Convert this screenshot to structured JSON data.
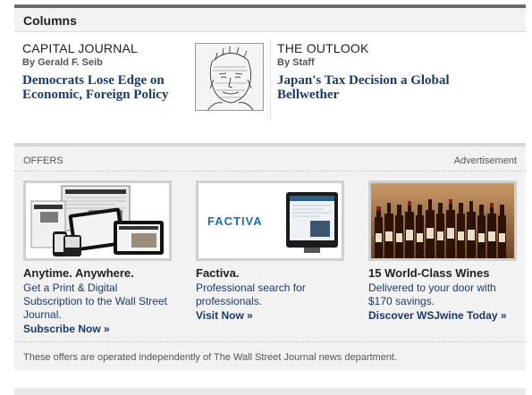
{
  "columns": {
    "header": "Columns",
    "left": {
      "kicker": "CAPITAL JOURNAL",
      "byline": "By Gerald F. Seib",
      "headline_line1": "Democrats Lose Edge on",
      "headline_line2": "Economic, Foreign Policy"
    },
    "right": {
      "kicker": "THE OUTLOOK",
      "byline": "By Staff",
      "headline_line1": "Japan's Tax Decision a Global",
      "headline_line2": "Bellwether"
    }
  },
  "offers": {
    "label": "OFFERS",
    "ad_label": "Advertisement",
    "items": [
      {
        "title": "Anytime. Anywhere.",
        "desc_line1": "Get a Print & Digital",
        "desc_line2": "Subscription to the Wall Street",
        "desc_line3": "Journal.",
        "cta": "Subscribe Now »"
      },
      {
        "title": "Factiva.",
        "desc_line1": "Professional search for",
        "desc_line2": "professionals.",
        "cta": "Visit Now »",
        "logo_text": "FACTIVA"
      },
      {
        "title": "15 World-Class Wines",
        "desc_line1": "Delivered to your door with",
        "desc_line2": "$170 savings.",
        "cta": "Discover WSJwine Today »"
      }
    ],
    "disclaimer": "These offers are operated independently of The Wall Street Journal news department."
  }
}
